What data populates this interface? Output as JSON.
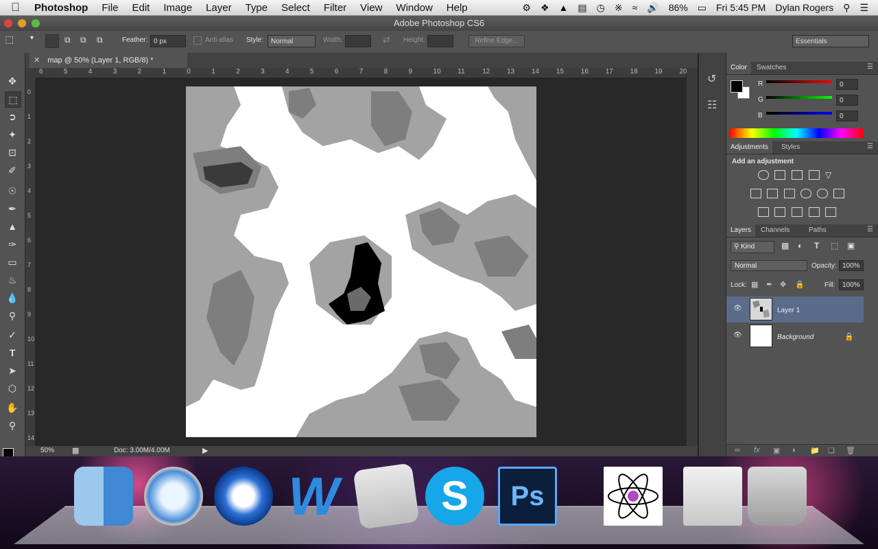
{
  "menubar": {
    "app_name": "Photoshop",
    "items": [
      "File",
      "Edit",
      "Image",
      "Layer",
      "Type",
      "Select",
      "Filter",
      "View",
      "Window",
      "Help"
    ],
    "battery": "86%",
    "clock": "Fri 5:45 PM",
    "user": "Dylan Rogers"
  },
  "window": {
    "title": "Adobe Photoshop CS6"
  },
  "options": {
    "feather_label": "Feather:",
    "feather_value": "0 px",
    "antialias_label": "Anti-alias",
    "style_label": "Style:",
    "style_value": "Normal",
    "width_label": "Width:",
    "height_label": "Height:",
    "refine_edge": "Refine Edge...",
    "workspace": "Essentials"
  },
  "document": {
    "tab_title": "map @ 50% (Layer 1, RGB/8) *",
    "hruler_ticks": [
      "6",
      "5",
      "4",
      "3",
      "2",
      "1",
      "0",
      "1",
      "2",
      "3",
      "4",
      "5",
      "6",
      "7",
      "8",
      "9",
      "10",
      "11",
      "12",
      "13",
      "14",
      "15",
      "16",
      "17",
      "18",
      "19",
      "20"
    ],
    "vruler_ticks": [
      "0",
      "1",
      "2",
      "3",
      "4",
      "5",
      "6",
      "7",
      "8",
      "9",
      "10",
      "11",
      "12",
      "13",
      "14"
    ],
    "zoom": "50%",
    "doc_size": "Doc: 3.00M/4.00M"
  },
  "color_panel": {
    "tabs": [
      "Color",
      "Swatches"
    ],
    "r_label": "R",
    "g_label": "G",
    "b_label": "B",
    "r": "0",
    "g": "0",
    "b": "0",
    "foreground": "#000000",
    "background": "#ffffff"
  },
  "adjustments_panel": {
    "tabs": [
      "Adjustments",
      "Styles"
    ],
    "heading": "Add an adjustment"
  },
  "layers_panel": {
    "tabs": [
      "Layers",
      "Channels",
      "Paths"
    ],
    "filter_kind": "Kind",
    "blend_mode": "Normal",
    "opacity_label": "Opacity:",
    "opacity": "100%",
    "lock_label": "Lock:",
    "fill_label": "Fill:",
    "fill": "100%",
    "layers": [
      {
        "name": "Layer 1",
        "selected": true
      },
      {
        "name": "Background",
        "selected": false,
        "locked": true
      }
    ]
  },
  "dock": {
    "apps": [
      "finder-icon",
      "safari-icon",
      "itunes-icon",
      "word-icon",
      "mail-icon",
      "skype-icon",
      "photoshop-icon",
      "atom-app-icon",
      "disk-utility-icon",
      "trash-icon"
    ]
  },
  "colors": {
    "panel_gray": "#535353",
    "canvas_bg": "#282828",
    "selected_layer": "#5b6b8a"
  }
}
